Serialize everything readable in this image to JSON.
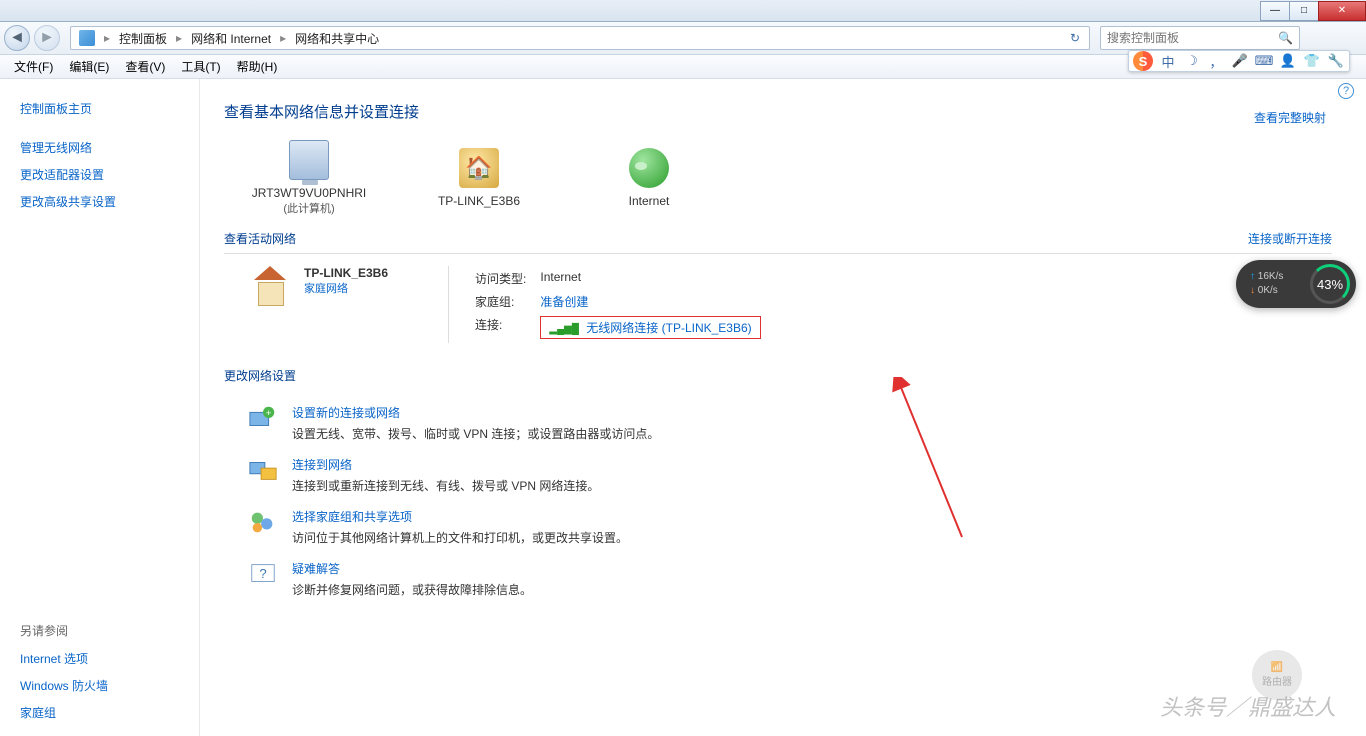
{
  "titlebar": {
    "min": "—",
    "max": "□",
    "close": "✕"
  },
  "breadcrumb": {
    "part1": "控制面板",
    "part2": "网络和 Internet",
    "part3": "网络和共享中心"
  },
  "search": {
    "placeholder": "搜索控制面板"
  },
  "ime": {
    "logo": "S",
    "lang": "中"
  },
  "menu": {
    "file": "文件(F)",
    "edit": "编辑(E)",
    "view": "查看(V)",
    "tools": "工具(T)",
    "help": "帮助(H)"
  },
  "sidebar": {
    "home": "控制面板主页",
    "items": [
      "管理无线网络",
      "更改适配器设置",
      "更改高级共享设置"
    ],
    "seealso_h": "另请参阅",
    "seealso": [
      "Internet 选项",
      "Windows 防火墙",
      "家庭组"
    ]
  },
  "content": {
    "heading": "查看基本网络信息并设置连接",
    "view_full_map": "查看完整映射",
    "nodes": {
      "pc": "JRT3WT9VU0PNHRI",
      "pc_sub": "(此计算机)",
      "router": "TP-LINK_E3B6",
      "internet": "Internet"
    },
    "active_heading": "查看活动网络",
    "connect_disconnect": "连接或断开连接",
    "active": {
      "name": "TP-LINK_E3B6",
      "type": "家庭网络",
      "access_k": "访问类型:",
      "access_v": "Internet",
      "home_k": "家庭组:",
      "home_v": "准备创建",
      "conn_k": "连接:",
      "conn_v": "无线网络连接 (TP-LINK_E3B6)"
    },
    "change_heading": "更改网络设置",
    "items": [
      {
        "title": "设置新的连接或网络",
        "desc": "设置无线、宽带、拨号、临时或 VPN 连接；或设置路由器或访问点。"
      },
      {
        "title": "连接到网络",
        "desc": "连接到或重新连接到无线、有线、拨号或 VPN 网络连接。"
      },
      {
        "title": "选择家庭组和共享选项",
        "desc": "访问位于其他网络计算机上的文件和打印机，或更改共享设置。"
      },
      {
        "title": "疑难解答",
        "desc": "诊断并修复网络问题，或获得故障排除信息。"
      }
    ]
  },
  "speed": {
    "up": "16K/s",
    "down": "0K/s",
    "pct": "43%"
  },
  "watermark": "头条号／鼎盛达人",
  "wm_badge": "路由器"
}
